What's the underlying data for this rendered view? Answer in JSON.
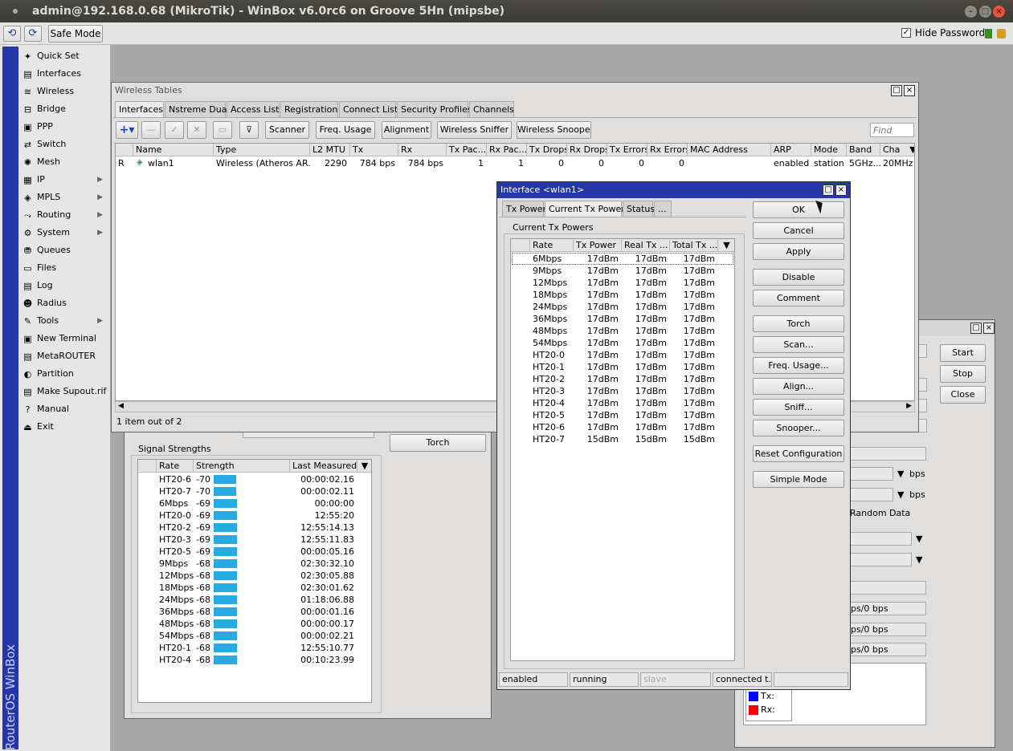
{
  "title": "admin@192.168.0.68 (MikroTik) - WinBox v6.0rc6 on Groove 5Hn (mipsbe)",
  "toolbar": {
    "safe_mode": "Safe Mode",
    "hide_passwords": "Hide Passwords"
  },
  "sidebar": {
    "brand": "RouterOS WinBox",
    "items": [
      {
        "label": "Quick Set",
        "icon": "quick-set-icon"
      },
      {
        "label": "Interfaces",
        "icon": "interfaces-icon"
      },
      {
        "label": "Wireless",
        "icon": "wireless-icon"
      },
      {
        "label": "Bridge",
        "icon": "bridge-icon"
      },
      {
        "label": "PPP",
        "icon": "ppp-icon"
      },
      {
        "label": "Switch",
        "icon": "switch-icon"
      },
      {
        "label": "Mesh",
        "icon": "mesh-icon"
      },
      {
        "label": "IP",
        "icon": "ip-icon",
        "sub": true
      },
      {
        "label": "MPLS",
        "icon": "mpls-icon",
        "sub": true
      },
      {
        "label": "Routing",
        "icon": "routing-icon",
        "sub": true
      },
      {
        "label": "System",
        "icon": "system-icon",
        "sub": true
      },
      {
        "label": "Queues",
        "icon": "queues-icon"
      },
      {
        "label": "Files",
        "icon": "files-icon"
      },
      {
        "label": "Log",
        "icon": "log-icon"
      },
      {
        "label": "Radius",
        "icon": "radius-icon"
      },
      {
        "label": "Tools",
        "icon": "tools-icon",
        "sub": true
      },
      {
        "label": "New Terminal",
        "icon": "terminal-icon"
      },
      {
        "label": "MetaROUTER",
        "icon": "metarouter-icon"
      },
      {
        "label": "Partition",
        "icon": "partition-icon"
      },
      {
        "label": "Make Supout.rif",
        "icon": "supout-icon"
      },
      {
        "label": "Manual",
        "icon": "manual-icon"
      },
      {
        "label": "Exit",
        "icon": "exit-icon"
      }
    ]
  },
  "wireless_tables": {
    "title": "Wireless Tables",
    "tabs": [
      "Interfaces",
      "Nstreme Dual",
      "Access List",
      "Registration",
      "Connect List",
      "Security Profiles",
      "Channels"
    ],
    "buttons": {
      "scanner": "Scanner",
      "freq_usage": "Freq. Usage",
      "alignment": "Alignment",
      "wireless_sniffer": "Wireless Sniffer",
      "wireless_snooper": "Wireless Snooper"
    },
    "find_placeholder": "Find",
    "columns": [
      "Name",
      "Type",
      "L2 MTU",
      "Tx",
      "Rx",
      "Tx Pac...",
      "Rx Pac...",
      "Tx Drops",
      "Rx Drops",
      "Tx Errors",
      "Rx Errors",
      "MAC Address",
      "ARP",
      "Mode",
      "Band",
      "Cha"
    ],
    "row": {
      "flag": "R",
      "name": "wlan1",
      "type": "Wireless (Atheros AR...",
      "l2mtu": "2290",
      "tx": "784 bps",
      "rx": "784 bps",
      "txp": "1",
      "rxp": "1",
      "txd": "0",
      "rxd": "0",
      "txe": "0",
      "rxe": "0",
      "mac": "",
      "arp": "enabled",
      "mode": "station",
      "band": "5GHz...",
      "cha": "20MHz"
    },
    "status": "1 item out of 2"
  },
  "signal": {
    "torch": "Torch",
    "group_label": "Signal Strengths",
    "columns": [
      "Rate",
      "Strength",
      "Last Measured"
    ],
    "rows": [
      {
        "rate": "HT20-6",
        "strength": "-70",
        "last": "00:00:02.16"
      },
      {
        "rate": "HT20-7",
        "strength": "-70",
        "last": "00:00:02.11"
      },
      {
        "rate": "6Mbps",
        "strength": "-69",
        "last": "00:00:00"
      },
      {
        "rate": "HT20-0",
        "strength": "-69",
        "last": "12:55:20"
      },
      {
        "rate": "HT20-2",
        "strength": "-69",
        "last": "12:55:14.13"
      },
      {
        "rate": "HT20-3",
        "strength": "-69",
        "last": "12:55:11.83"
      },
      {
        "rate": "HT20-5",
        "strength": "-69",
        "last": "00:00:05.16"
      },
      {
        "rate": "9Mbps",
        "strength": "-68",
        "last": "02:30:32.10"
      },
      {
        "rate": "12Mbps",
        "strength": "-68",
        "last": "02:30:05.88"
      },
      {
        "rate": "18Mbps",
        "strength": "-68",
        "last": "02:30:01.62"
      },
      {
        "rate": "24Mbps",
        "strength": "-68",
        "last": "01:18:06.88"
      },
      {
        "rate": "36Mbps",
        "strength": "-68",
        "last": "00:00:01.16"
      },
      {
        "rate": "48Mbps",
        "strength": "-68",
        "last": "00:00:00.17"
      },
      {
        "rate": "54Mbps",
        "strength": "-68",
        "last": "00:00:02.21"
      },
      {
        "rate": "HT20-1",
        "strength": "-68",
        "last": "12:55:10.77"
      },
      {
        "rate": "HT20-4",
        "strength": "-68",
        "last": "00:10:23.99"
      }
    ]
  },
  "back_window": {
    "buttons": {
      "start": "Start",
      "stop": "Stop",
      "close": "Close"
    },
    "bps1": "bps",
    "bps2": "bps",
    "random_data": "Random Data",
    "fields": [
      "ps/0 bps",
      "ps/0 bps",
      "ps/0 bps"
    ],
    "legend": {
      "tx": "Tx:",
      "rx": "Rx:",
      "tx_color": "#0000ff",
      "rx_color": "#ff0000"
    }
  },
  "iface": {
    "title": "Interface <wlan1>",
    "tabs": [
      "Tx Power",
      "Current Tx Power",
      "Status",
      "..."
    ],
    "group_label": "Current Tx Powers",
    "columns": [
      "Rate",
      "Tx Power",
      "Real Tx ...",
      "Total Tx ..."
    ],
    "rows": [
      {
        "rate": "6Mbps",
        "tx": "17dBm",
        "real": "17dBm",
        "total": "17dBm"
      },
      {
        "rate": "9Mbps",
        "tx": "17dBm",
        "real": "17dBm",
        "total": "17dBm"
      },
      {
        "rate": "12Mbps",
        "tx": "17dBm",
        "real": "17dBm",
        "total": "17dBm"
      },
      {
        "rate": "18Mbps",
        "tx": "17dBm",
        "real": "17dBm",
        "total": "17dBm"
      },
      {
        "rate": "24Mbps",
        "tx": "17dBm",
        "real": "17dBm",
        "total": "17dBm"
      },
      {
        "rate": "36Mbps",
        "tx": "17dBm",
        "real": "17dBm",
        "total": "17dBm"
      },
      {
        "rate": "48Mbps",
        "tx": "17dBm",
        "real": "17dBm",
        "total": "17dBm"
      },
      {
        "rate": "54Mbps",
        "tx": "17dBm",
        "real": "17dBm",
        "total": "17dBm"
      },
      {
        "rate": "HT20-0",
        "tx": "17dBm",
        "real": "17dBm",
        "total": "17dBm"
      },
      {
        "rate": "HT20-1",
        "tx": "17dBm",
        "real": "17dBm",
        "total": "17dBm"
      },
      {
        "rate": "HT20-2",
        "tx": "17dBm",
        "real": "17dBm",
        "total": "17dBm"
      },
      {
        "rate": "HT20-3",
        "tx": "17dBm",
        "real": "17dBm",
        "total": "17dBm"
      },
      {
        "rate": "HT20-4",
        "tx": "17dBm",
        "real": "17dBm",
        "total": "17dBm"
      },
      {
        "rate": "HT20-5",
        "tx": "17dBm",
        "real": "17dBm",
        "total": "17dBm"
      },
      {
        "rate": "HT20-6",
        "tx": "17dBm",
        "real": "17dBm",
        "total": "17dBm"
      },
      {
        "rate": "HT20-7",
        "tx": "15dBm",
        "real": "15dBm",
        "total": "15dBm"
      }
    ],
    "buttons": [
      "OK",
      "Cancel",
      "Apply",
      "Disable",
      "Comment",
      "Torch",
      "Scan...",
      "Freq. Usage...",
      "Align...",
      "Sniff...",
      "Snooper...",
      "Reset Configuration",
      "Simple Mode"
    ],
    "status": [
      "enabled",
      "running",
      "slave",
      "connected t..."
    ]
  }
}
